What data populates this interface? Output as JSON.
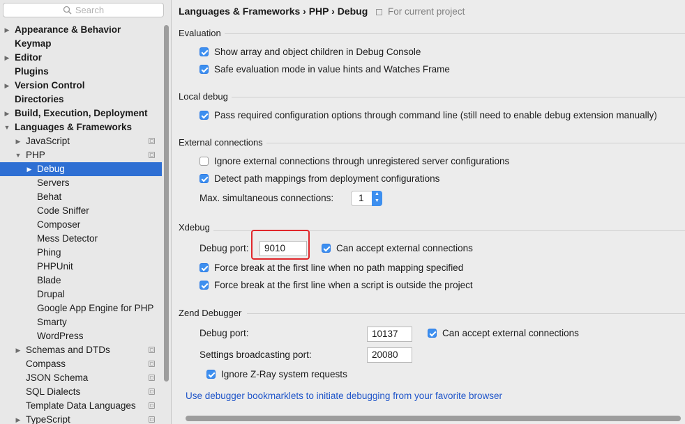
{
  "search": {
    "placeholder": "Search"
  },
  "tree": [
    {
      "label": "Appearance & Behavior",
      "arrow": "▶",
      "bold": true
    },
    {
      "label": "Keymap",
      "bold": true
    },
    {
      "label": "Editor",
      "arrow": "▶",
      "bold": true
    },
    {
      "label": "Plugins",
      "bold": true
    },
    {
      "label": "Version Control",
      "arrow": "▶",
      "bold": true
    },
    {
      "label": "Directories",
      "bold": true
    },
    {
      "label": "Build, Execution, Deployment",
      "arrow": "▶",
      "bold": true
    },
    {
      "label": "Languages & Frameworks",
      "arrow": "▼",
      "bold": true
    },
    {
      "label": "JavaScript",
      "arrow": "▶",
      "project": true
    },
    {
      "label": "PHP",
      "arrow": "▼",
      "project": true
    },
    {
      "label": "Debug",
      "arrow": "▶",
      "selected": true
    },
    {
      "label": "Servers"
    },
    {
      "label": "Behat"
    },
    {
      "label": "Code Sniffer"
    },
    {
      "label": "Composer"
    },
    {
      "label": "Mess Detector"
    },
    {
      "label": "Phing"
    },
    {
      "label": "PHPUnit"
    },
    {
      "label": "Blade"
    },
    {
      "label": "Drupal"
    },
    {
      "label": "Google App Engine for PHP"
    },
    {
      "label": "Smarty"
    },
    {
      "label": "WordPress"
    },
    {
      "label": "Schemas and DTDs",
      "arrow": "▶",
      "project": true
    },
    {
      "label": "Compass",
      "project": true
    },
    {
      "label": "JSON Schema",
      "project": true
    },
    {
      "label": "SQL Dialects",
      "project": true
    },
    {
      "label": "Template Data Languages",
      "project": true
    },
    {
      "label": "TypeScript",
      "arrow": "▶",
      "project": true
    }
  ],
  "breadcrumb": {
    "path": "Languages & Frameworks › PHP › Debug",
    "note": "For current project"
  },
  "evaluation": {
    "title": "Evaluation",
    "show_children": "Show array and object children in Debug Console",
    "safe_mode": "Safe evaluation mode in value hints and Watches Frame"
  },
  "local_debug": {
    "title": "Local debug",
    "pass_options": "Pass required configuration options through command line (still need to enable debug extension manually)"
  },
  "external": {
    "title": "External connections",
    "ignore": "Ignore external connections through unregistered server configurations",
    "detect": "Detect path mappings from deployment configurations",
    "max_label": "Max. simultaneous connections:",
    "max_value": "1"
  },
  "xdebug": {
    "title": "Xdebug",
    "port_label": "Debug port:",
    "port_value": "9010",
    "accept_external": "Can accept external connections",
    "force_no_mapping": "Force break at the first line when no path mapping specified",
    "force_outside": "Force break at the first line when a script is outside the project"
  },
  "zend": {
    "title": "Zend Debugger",
    "port_label": "Debug port:",
    "port_value": "10137",
    "accept_external": "Can accept external connections",
    "broadcast_label": "Settings broadcasting port:",
    "broadcast_value": "20080",
    "ignore_zray": "Ignore Z-Ray system requests"
  },
  "link": "Use debugger bookmarklets to initiate debugging from your favorite browser",
  "colors": {
    "accent": "#3d8fef",
    "selection": "#2e6fd3",
    "highlight_border": "#e0262b",
    "link": "#1f55c9"
  }
}
